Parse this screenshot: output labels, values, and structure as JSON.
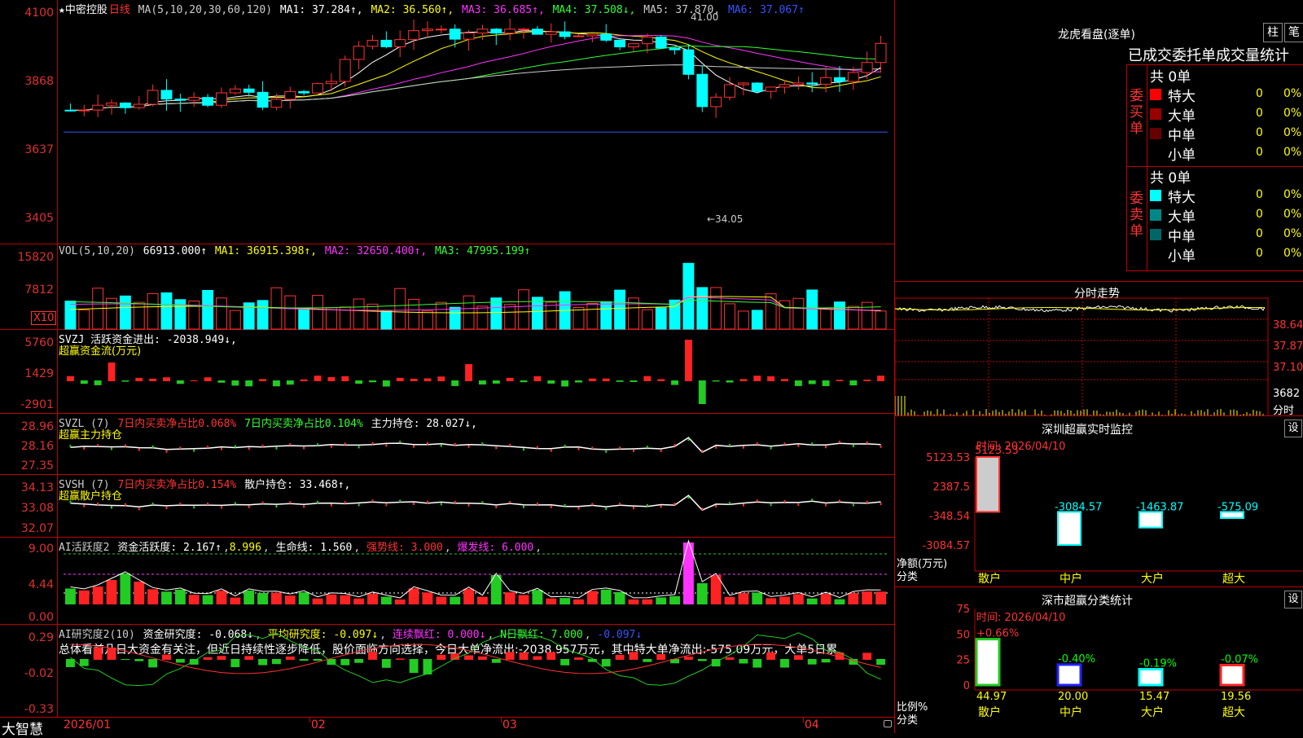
{
  "kline": {
    "stock": "★中密控股",
    "period": "日线",
    "ma_label": "MA(5,10,20,30,60,120)",
    "ma": [
      {
        "label": "MA1: 37.284↑",
        "color": "#ffffff"
      },
      {
        "label": "MA2: 36.560↑",
        "color": "#ffff00"
      },
      {
        "label": "MA3: 36.685↑",
        "color": "#ff33ff"
      },
      {
        "label": "MA4: 37.508↓",
        "color": "#33ff33"
      },
      {
        "label": "MA5: 37.870",
        "color": "#cccccc"
      },
      {
        "label": "MA6: 37.067↑",
        "color": "#3355ff"
      }
    ],
    "yticks": [
      "4100",
      "3868",
      "3637",
      "3405"
    ],
    "high_note": "41.00",
    "low_note": "←34.05"
  },
  "vol": {
    "title": "VOL(5,10,20)",
    "value": "66913.000↑",
    "ma": [
      {
        "label": "MA1: 36915.398↑",
        "color": "#ffff00"
      },
      {
        "label": "MA2: 32650.400↑",
        "color": "#ff33ff"
      },
      {
        "label": "MA3: 47995.199↑",
        "color": "#33ff33"
      }
    ],
    "yticks": [
      "15820",
      "7812"
    ],
    "unit": "X10"
  },
  "svzj": {
    "title": "SVZJ  活跃资金进出: -2038.949↓,",
    "sub": "超赢资金流(万元)",
    "yticks": [
      "5760",
      "1429",
      "-2901"
    ]
  },
  "svzl": {
    "title": "SVZL (7) ",
    "t1": "7日内买卖净占比0.068%",
    "t2": "7日内买卖净占比0.104%",
    "t3": "主力持仓: 28.027↓,",
    "sub": "超赢主力持仓",
    "yticks": [
      "28.96",
      "28.16",
      "27.35"
    ]
  },
  "svsh": {
    "title": "SVSH (7) ",
    "t1": "7日内买卖净占比0.154%",
    "t3": "散户持仓: 33.468↑,",
    "sub": "超赢散户持仓",
    "yticks": [
      "34.13",
      "33.08",
      "32.07"
    ]
  },
  "ai1": {
    "title": "AI活跃度2",
    "t1": "资金活跃度: 2.167↑",
    "t2": "8.996",
    "t3": "生命线: 1.560",
    "t4": "强势线: 3.000",
    "t5": "爆发线: 6.000",
    "yticks": [
      "9.00",
      "4.44",
      "0.00"
    ]
  },
  "ai2": {
    "title": "AI研究度2(10)",
    "t1": "资金研究度: -0.068↓",
    "t2": "平均研究度: -0.097↓",
    "t3": "连续飘红: 0.000↓",
    "t4": "N日飘红: 7.000",
    "t5": "-0.097↓",
    "summary": "总体看前几日大资金有关注，但近日持续性逐步降低，股价面临方向选择，今日大单净流出:-2038.957万元，其中特大单净流出:-575.09万元，大单5日累",
    "yticks": [
      "0.29",
      "-0.02",
      "-0.33"
    ]
  },
  "xaxis": {
    "app": "大智慧",
    "labels": [
      "2026/01",
      "02",
      "03",
      "04"
    ]
  },
  "lhb": {
    "title": "龙虎看盘(逐单)",
    "btn1": "柱",
    "btn2": "笔",
    "tabs": "已成交委托单成交量统计",
    "buy": {
      "side": "委买单",
      "total": "共 0单",
      "rows": [
        {
          "name": "特大",
          "v": "0",
          "p": "0%",
          "c": "#ff0000"
        },
        {
          "name": "大单",
          "v": "0",
          "p": "0%",
          "c": "#990000"
        },
        {
          "name": "中单",
          "v": "0",
          "p": "0%",
          "c": "#660000"
        },
        {
          "name": "小单",
          "v": "0",
          "p": "0%",
          "c": "#000000"
        }
      ]
    },
    "sell": {
      "side": "委卖单",
      "total": "共 0单",
      "rows": [
        {
          "name": "特大",
          "v": "0",
          "p": "0%",
          "c": "#00ffff"
        },
        {
          "name": "大单",
          "v": "0",
          "p": "0%",
          "c": "#008888"
        },
        {
          "name": "中单",
          "v": "0",
          "p": "0%",
          "c": "#006666"
        },
        {
          "name": "小单",
          "v": "0",
          "p": "0%",
          "c": "#000000"
        }
      ]
    }
  },
  "fenshi": {
    "title": "分时走势",
    "yticks": [
      "38.64",
      "37.87",
      "37.10"
    ],
    "vol": "3682",
    "unit": "分时"
  },
  "monitor": {
    "title": "深圳超赢实时监控",
    "btn": "设",
    "date": "时间: 2026/04/10",
    "yticks": [
      "5123.53",
      "2387.5",
      "-348.54",
      "-3084.57"
    ],
    "ylabel": "净额(万元)",
    "xlabel": "分类",
    "bars": [
      {
        "name": "散户",
        "value": 5123.53,
        "label": "5123.53"
      },
      {
        "name": "中户",
        "value": -3084.57,
        "label": "-3084.57"
      },
      {
        "name": "大户",
        "value": -1463.87,
        "label": "-1463.87"
      },
      {
        "name": "超大",
        "value": -575.09,
        "label": "-575.09"
      }
    ]
  },
  "classstat": {
    "title": "深市超赢分类统计",
    "btn": "设",
    "date": "时间: 2026/04/10",
    "yticks": [
      "75",
      "50",
      "25",
      "0"
    ],
    "ylabel": "比例%",
    "xlabel": "分类",
    "bars": [
      {
        "name": "散户",
        "value": 44.97,
        "label": "44.97",
        "delta": "+0.66%",
        "c": "#22cc22"
      },
      {
        "name": "中户",
        "value": 20.0,
        "label": "20.00",
        "delta": "-0.40%",
        "c": "#2222ff"
      },
      {
        "name": "大户",
        "value": 15.47,
        "label": "15.47",
        "delta": "-0.19%",
        "c": "#00ffff"
      },
      {
        "name": "超大",
        "value": 19.56,
        "label": "19.56",
        "delta": "-0.07%",
        "c": "#ff2222"
      }
    ]
  }
}
